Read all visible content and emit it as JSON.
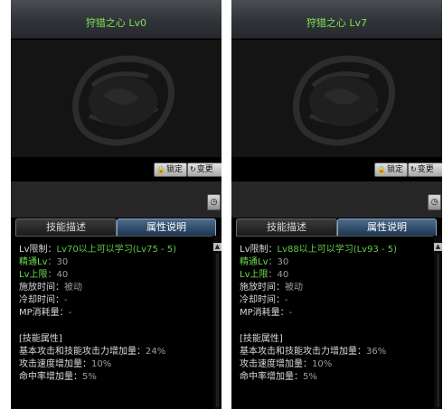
{
  "panels": [
    {
      "title": "狩猎之心 Lv0",
      "buttons": {
        "lock": "锁定",
        "change": "变更"
      },
      "tabs": {
        "desc": "技能描述",
        "attr": "属性说明"
      },
      "lv_limit_label": "Lv限制：",
      "lv_limit_value": "Lv70以上可以学习(Lv75 - 5)",
      "mastery_label": "精通Lv",
      "mastery_value": "：30",
      "cap_label": "Lv上限",
      "cap_value": "：40",
      "cast_label": "施放时间：",
      "cast_value": "被动",
      "cooldown_label": "冷却时间：",
      "cooldown_value": "-",
      "mp_label": "MP消耗量：",
      "mp_value": "-",
      "section": "[技能属性]",
      "attrs": [
        {
          "label": "基本攻击和技能攻击力增加量：",
          "value": "24%"
        },
        {
          "label": "攻击速度增加量：",
          "value": "10%"
        },
        {
          "label": "命中率增加量：",
          "value": "5%"
        }
      ]
    },
    {
      "title": "狩猎之心 Lv7",
      "buttons": {
        "lock": "锁定",
        "change": "变更"
      },
      "tabs": {
        "desc": "技能描述",
        "attr": "属性说明"
      },
      "lv_limit_label": "Lv限制：",
      "lv_limit_value": "Lv88以上可以学习(Lv93 - 5)",
      "mastery_label": "精通Lv",
      "mastery_value": "：30",
      "cap_label": "Lv上限",
      "cap_value": "：40",
      "cast_label": "施放时间：",
      "cast_value": "被动",
      "cooldown_label": "冷却时间：",
      "cooldown_value": "-",
      "mp_label": "MP消耗量：",
      "mp_value": "-",
      "section": "[技能属性]",
      "attrs": [
        {
          "label": "基本攻击和技能攻击力增加量：",
          "value": "36%"
        },
        {
          "label": "攻击速度增加量：",
          "value": "10%"
        },
        {
          "label": "命中率增加量：",
          "value": "5%"
        }
      ]
    }
  ],
  "icons": {
    "lock": "lock-icon",
    "change": "change-icon",
    "clock": "clock-icon",
    "scroll_up": "scroll-up-icon",
    "emblem": "emblem-icon"
  },
  "colors": {
    "title": "#7fe356",
    "green_text": "#6fdd4f",
    "tab_active": "#1d3550"
  }
}
